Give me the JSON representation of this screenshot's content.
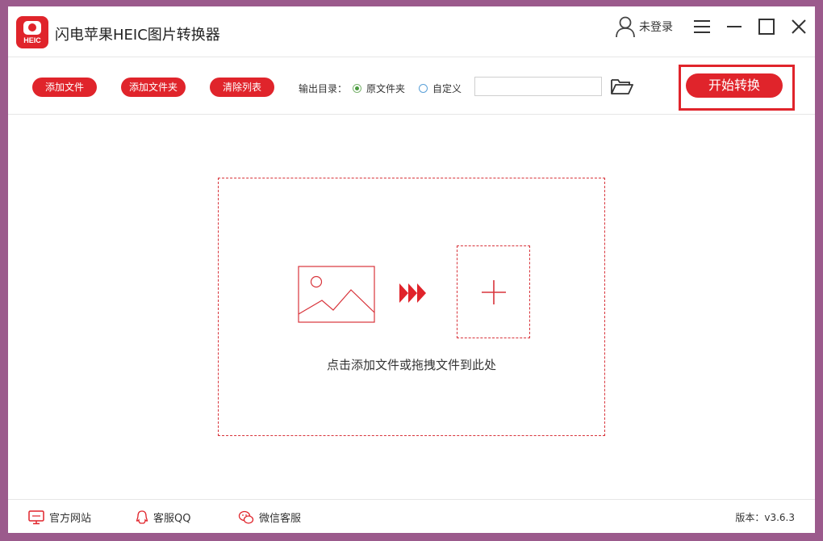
{
  "app": {
    "title": "闪电苹果HEIC图片转换器",
    "logo_text": "HEIC"
  },
  "header": {
    "login_label": "未登录"
  },
  "toolbar": {
    "add_file_label": "添加文件",
    "add_folder_label": "添加文件夹",
    "clear_list_label": "清除列表",
    "output_label": "输出目录：",
    "radio_original_label": "原文件夹",
    "radio_custom_label": "自定义",
    "output_path_value": "",
    "start_label": "开始转换"
  },
  "dropzone": {
    "hint": "点击添加文件或拖拽文件到此处"
  },
  "footer": {
    "website_label": "官方网站",
    "qq_label": "客服QQ",
    "wechat_label": "微信客服",
    "version_text": "版本：v3.6.3"
  },
  "colors": {
    "accent": "#e0242b",
    "frame": "#9b5a8c",
    "radio_selected": "#4a9b3f"
  },
  "icons": [
    "user-icon",
    "menu-icon",
    "minimize-icon",
    "maximize-icon",
    "close-icon",
    "folder-open-icon",
    "image-icon",
    "triple-arrow-icon",
    "plus-icon",
    "monitor-icon",
    "qq-icon",
    "wechat-icon"
  ]
}
